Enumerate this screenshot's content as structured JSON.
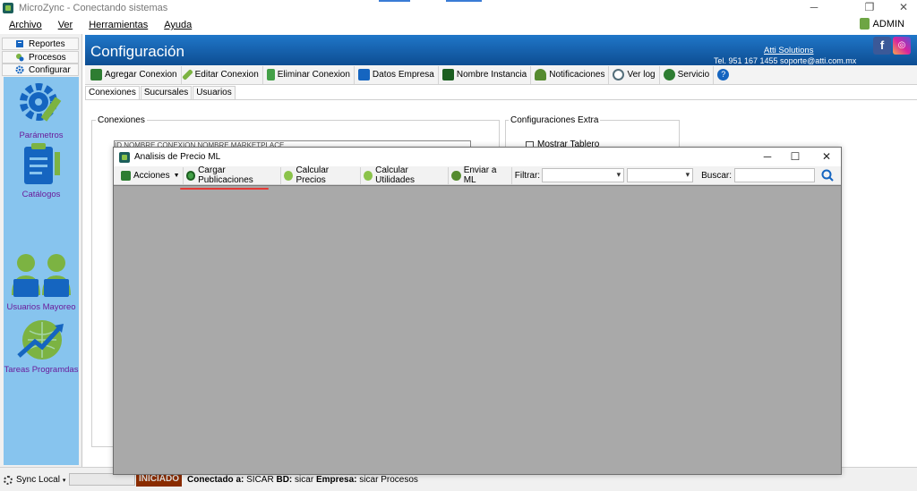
{
  "window": {
    "title": "MicroZync - Conectando sistemas",
    "controls": [
      "─",
      "❐",
      "✕"
    ]
  },
  "menu": {
    "items": [
      "Archivo",
      "Ver",
      "Herramientas",
      "Ayuda"
    ],
    "user": "ADMIN"
  },
  "leftnav": {
    "tabs": [
      "Reportes",
      "Procesos",
      "Configurar"
    ],
    "items": [
      "Parámetros",
      "Catálogos",
      "Usuarios Mayoreo",
      "Tareas Programdas"
    ]
  },
  "header": {
    "title": "Configuración",
    "company": "Atti Solutions",
    "contact": "Tel. 951 167 1455  soporte@atti.com.mx",
    "fb": "f",
    "ig": "◎"
  },
  "toolbar": {
    "buttons": [
      "Agregar Conexion",
      "Editar Conexion",
      "Eliminar Conexion",
      "Datos Empresa",
      "Nombre Instancia",
      "Notificaciones",
      "Ver log",
      "Servicio"
    ],
    "colors": [
      "#2e7d32",
      "#7cb342",
      "#43a047",
      "#1565c0",
      "#1b5e20",
      "#558b2f",
      "#546e7a",
      "#2e7d32"
    ]
  },
  "tabs": [
    "Conexiones",
    "Sucursales",
    "Usuarios"
  ],
  "content": {
    "group1": "Conexiones",
    "group2": "Configuraciones Extra",
    "grid_headers": "ID    NOMBRE CONEXION                                          NOMBRE MARKETPLACE",
    "checkbox_label": "Mostrar Tablero"
  },
  "dialog": {
    "title": "Analisis de Precio ML",
    "controls": [
      "─",
      "☐",
      "✕"
    ],
    "toolbar": {
      "acciones": "Acciones",
      "cargar": "Cargar Publicaciones",
      "calc_precios": "Calcular Precios",
      "calc_utilidades": "Calcular Utilidades",
      "enviar": "Enviar a ML",
      "filtrar": "Filtrar:",
      "buscar": "Buscar:"
    }
  },
  "status": {
    "sync": "Sync Local",
    "state": "INICIADO",
    "conectado_label": "Conectado a:",
    "conectado_value": "SICAR",
    "bd_label": "BD:",
    "bd_value": "sicar",
    "empresa_label": "Empresa:",
    "empresa_value": "sicar",
    "extra": "Procesos"
  }
}
